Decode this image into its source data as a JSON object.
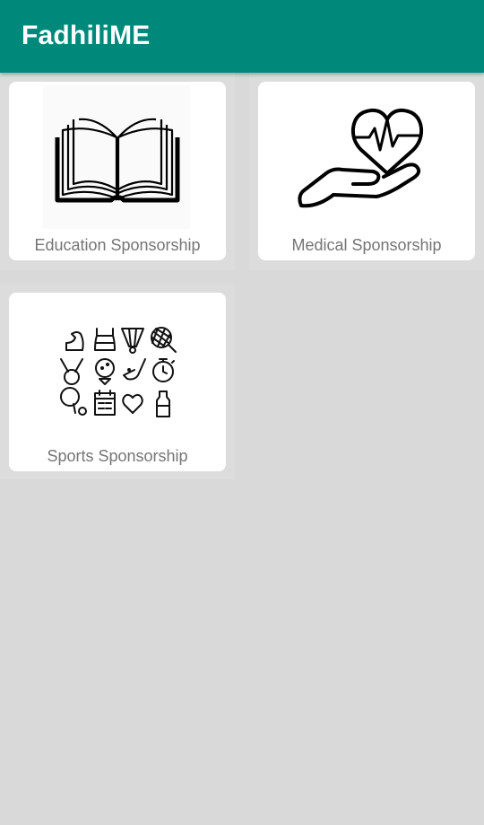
{
  "app_bar": {
    "title": "FadhiliME",
    "color": "#00897b"
  },
  "cards": [
    {
      "label": "Education Sponsorship",
      "icon": "open-book-icon"
    },
    {
      "label": "Medical Sponsorship",
      "icon": "heart-in-hand-icon"
    },
    {
      "label": "Sports Sponsorship",
      "icon": "sports-equipment-icon"
    }
  ]
}
